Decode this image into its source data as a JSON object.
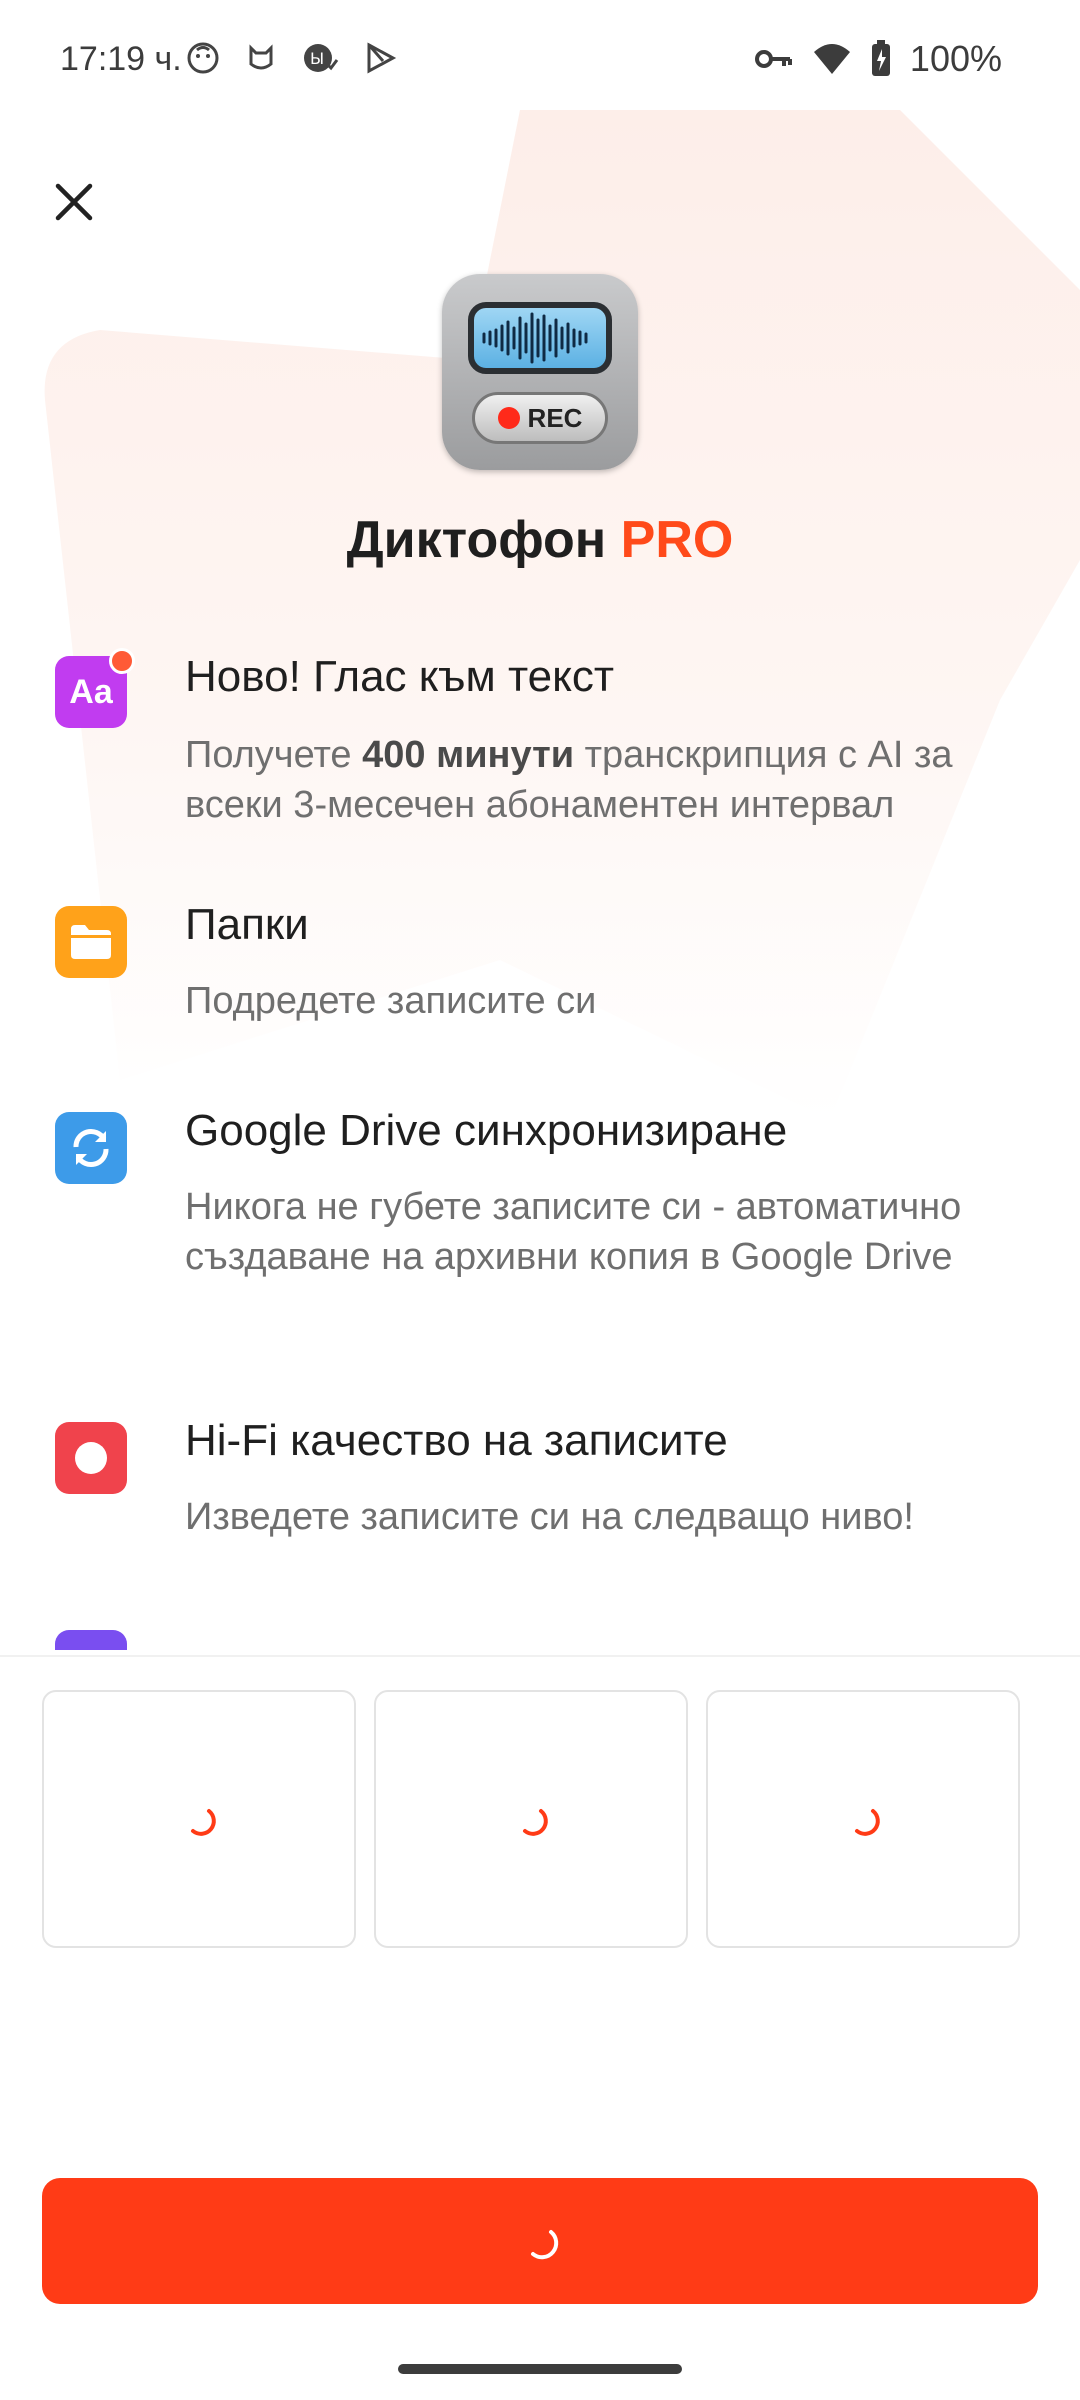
{
  "status_bar": {
    "time": "17:19 ч.",
    "battery_text": "100%"
  },
  "header": {
    "app_name": "Диктофон",
    "pro_label": "PRO",
    "rec_label": "REC"
  },
  "features": [
    {
      "icon": "text-aa-icon",
      "icon_text": "Aa",
      "color": "#c13cf0",
      "title": "Ново! Глас към текст",
      "desc_pre": "Получете ",
      "desc_bold": "400 минути",
      "desc_post": " транскрипция с AI за всеки 3-месечен абонаментен интервал"
    },
    {
      "icon": "folder-icon",
      "color": "#ffa21a",
      "title": "Папки",
      "desc": "Подредете записите си"
    },
    {
      "icon": "sync-icon",
      "color": "#3d9be9",
      "title": "Google Drive синхронизиране",
      "desc": "Никога не губете записите си - автоматично създаване на архивни копия в Google Drive"
    },
    {
      "icon": "record-icon",
      "color": "#f0434c",
      "title": "Hi-Fi качество на записите",
      "desc": "Изведете записите си на следващо ниво!"
    }
  ],
  "colors": {
    "accent": "#ff3b16",
    "pro": "#ff4a1a"
  }
}
